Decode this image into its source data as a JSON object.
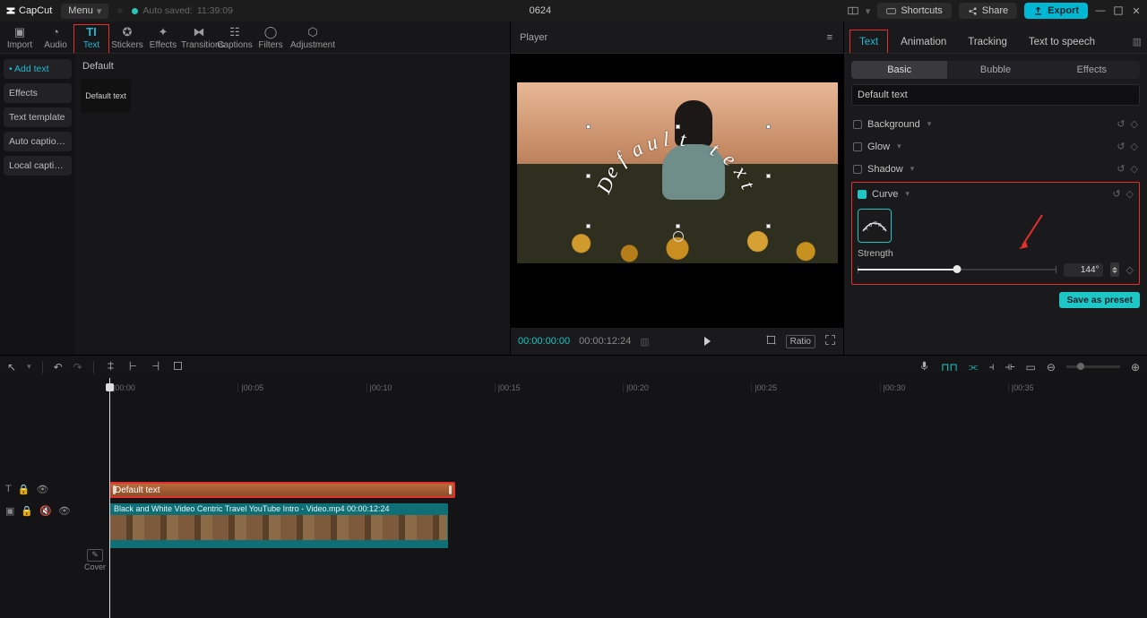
{
  "app_name": "CapCut",
  "menu_label": "Menu",
  "autosave_label": "Auto saved:",
  "autosave_time": "11:39:09",
  "project_title": "0624",
  "shortcuts_label": "Shortcuts",
  "share_label": "Share",
  "export_label": "Export",
  "asset_tabs": {
    "import": "Import",
    "audio": "Audio",
    "text": "Text",
    "stickers": "Stickers",
    "effects": "Effects",
    "transitions": "Transitions",
    "captions": "Captions",
    "filters": "Filters",
    "adjustment": "Adjustment"
  },
  "left_sidebar": {
    "add_text": "Add text",
    "effects": "Effects",
    "text_template": "Text template",
    "auto_captions": "Auto captio…",
    "local_captions": "Local capti…"
  },
  "left_content": {
    "section": "Default",
    "thumb_label": "Default text"
  },
  "player": {
    "title": "Player",
    "tc_current": "00:00:00:00",
    "tc_total": "00:00:12:24",
    "ratio_label": "Ratio",
    "overlay_text": "Default text"
  },
  "right": {
    "tabs": {
      "text": "Text",
      "animation": "Animation",
      "tracking": "Tracking",
      "tts": "Text to speech"
    },
    "sub": {
      "basic": "Basic",
      "bubble": "Bubble",
      "effects": "Effects"
    },
    "field_value": "Default text",
    "props": {
      "background": "Background",
      "glow": "Glow",
      "shadow": "Shadow",
      "curve": "Curve"
    },
    "strength_label": "Strength",
    "strength_value": "144°",
    "preset_label": "Save as preset"
  },
  "ruler": [
    "|00:00",
    "|00:05",
    "|00:10",
    "|00:15",
    "|00:20",
    "|00:25",
    "|00:30",
    "|00:35"
  ],
  "clip_text": "Default text",
  "clip_video": "Black and White Video Centric Travel YouTube Intro - Video.mp4   00:00:12:24",
  "cover_label": "Cover"
}
